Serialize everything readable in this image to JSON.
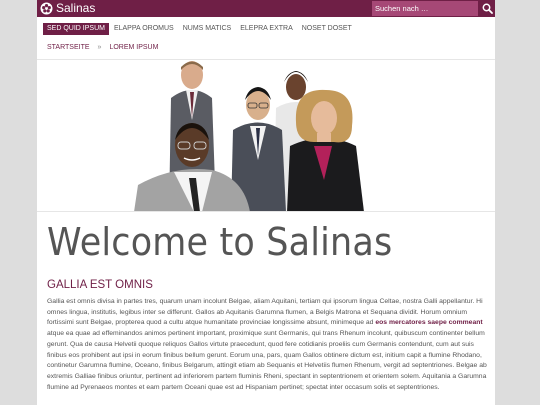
{
  "header": {
    "title": "Salinas",
    "search_placeholder": "Suchen nach …",
    "icons": [
      "flower-logo-icon",
      "search-icon"
    ]
  },
  "nav": {
    "items": [
      {
        "label": "Sed quid ipsum",
        "active": true
      },
      {
        "label": "Elappa oromus",
        "active": false
      },
      {
        "label": "Nums matics",
        "active": false
      },
      {
        "label": "Elepra extra",
        "active": false
      },
      {
        "label": "Noset doset",
        "active": false
      }
    ]
  },
  "breadcrumb": {
    "items": [
      "Startseite",
      "Lorem ipsum"
    ],
    "separator": "»"
  },
  "main": {
    "heading": "Welcome to Salinas",
    "subheading": "Gallia est omnis",
    "paragraph_before": "Gallia est omnis divisa in partes tres, quarum unam incolunt Belgae, aliam Aquitani, tertiam qui ipsorum lingua Celtae, nostra Galli appellantur. Hi omnes lingua, institutis, legibus inter se differunt. Gallos ab Aquitanis Garumna flumen, a Belgis Matrona et Sequana dividit. Horum omnium fortissimi sunt Belgae, propterea quod a cultu atque humanitate provinciae longissime absunt, minimeque ad ",
    "paragraph_bold": "eos mercatores saepe commeant",
    "paragraph_after": " atque ea quae ad effeminandos animos pertinent important, proximique sunt Germanis, qui trans Rhenum incolunt, quibuscum continenter bellum gerunt. Qua de causa Helvetii quoque reliquos Gallos virtute praecedunt, quod fere cotidianis proeliis cum Germanis contendunt, cum aut suis finibus eos prohibent aut ipsi in eorum finibus bellum gerunt. Eorum una, pars, quam Gallos obtinere dictum est, initium capit a flumine Rhodano, continetur Garumna flumine, Oceano, finibus Belgarum, attingit etiam ab Sequanis et Helvetiis flumen Rhenum, vergit ad septentriones. Belgae ab extremis Galliae finibus oriuntur, pertinent ad inferiorem partem fluminis Rheni, spectant in septentrionem et orientem solem. Aquitania a Garumna flumine ad Pyrenaeos montes et eam partem Oceani quae est ad Hispaniam pertinet; spectat inter occasum solis et septentriones."
  },
  "colors": {
    "brand": "#6f1f46",
    "search_bg": "#a64876",
    "text": "#555555",
    "page_bg": "#dddddd"
  }
}
